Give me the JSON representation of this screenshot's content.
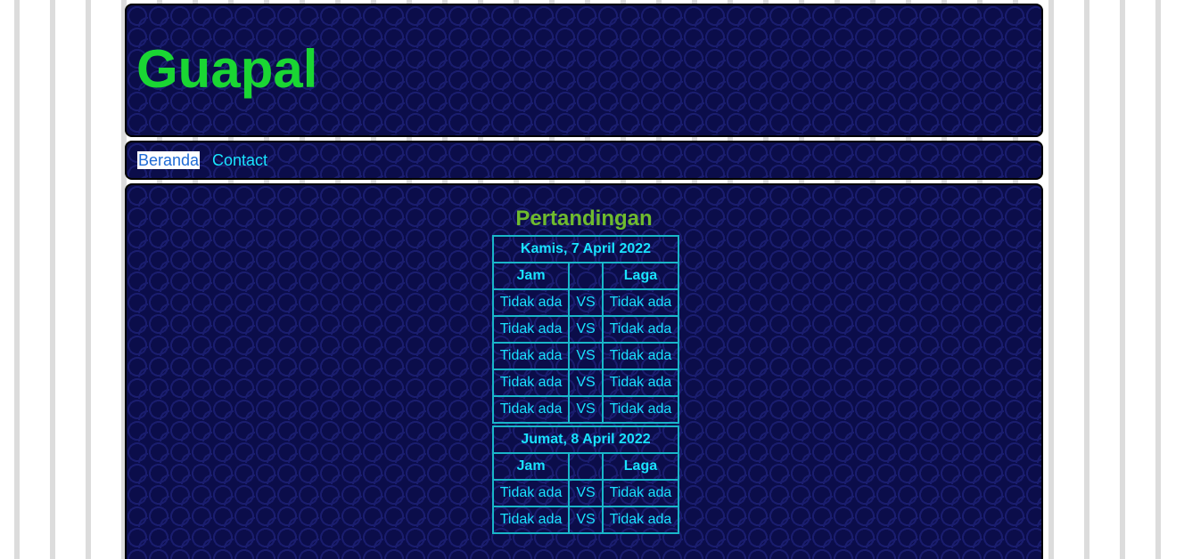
{
  "site": {
    "title": "Guapal"
  },
  "nav": {
    "items": [
      {
        "label": "Beranda"
      },
      {
        "label": "Contact"
      }
    ]
  },
  "main": {
    "section_title": "Pertandingan",
    "days": [
      {
        "date": "Kamis, 7 April 2022",
        "header_jam": "Jam",
        "header_laga": "Laga",
        "rows": [
          {
            "jam": "Tidak ada",
            "vs": "VS",
            "laga": "Tidak ada"
          },
          {
            "jam": "Tidak ada",
            "vs": "VS",
            "laga": "Tidak ada"
          },
          {
            "jam": "Tidak ada",
            "vs": "VS",
            "laga": "Tidak ada"
          },
          {
            "jam": "Tidak ada",
            "vs": "VS",
            "laga": "Tidak ada"
          },
          {
            "jam": "Tidak ada",
            "vs": "VS",
            "laga": "Tidak ada"
          }
        ]
      },
      {
        "date": "Jumat, 8 April 2022",
        "header_jam": "Jam",
        "header_laga": "Laga",
        "rows": [
          {
            "jam": "Tidak ada",
            "vs": "VS",
            "laga": "Tidak ada"
          },
          {
            "jam": "Tidak ada",
            "vs": "VS",
            "laga": "Tidak ada"
          }
        ]
      }
    ]
  },
  "colors": {
    "title_green": "#1ad633",
    "section_green": "#6fbb2e",
    "cyan_text": "#19e3ff",
    "panel_bg": "#0b0d4a"
  }
}
